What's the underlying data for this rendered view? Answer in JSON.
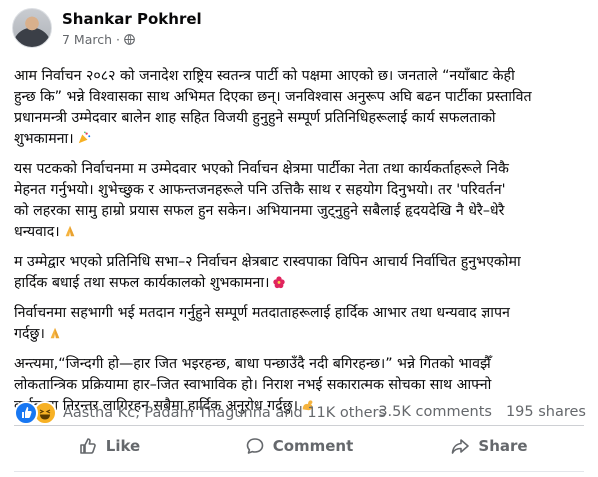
{
  "post": {
    "author": "Shankar Pokhrel",
    "date": "7 March",
    "paragraphs": [
      {
        "lines": [
          "आम निर्वाचन २०८२ को जनादेश राष्ट्रिय स्वतन्त्र पार्टी को पक्षमा आएको छ। जनताले “नयाँबाट केही",
          "हुन्छ कि” भन्ने विश्वासका साथ अभिमत दिएका छन्। जनविश्वास अनुरूप अघि बढन पार्टीका प्रस्तावित",
          "प्रधानमन्त्री उम्मेदवार बालेन शाह सहित विजयी हुनुहुने सम्पूर्ण प्रतिनिधिहरूलाई कार्य सफलताको",
          "शुभकामना।"
        ],
        "emoji": "party-popper-emoji"
      },
      {
        "lines": [
          "यस पटकको निर्वाचनमा म उम्मेदवार भएको निर्वाचन क्षेत्रमा पार्टीका नेता तथा कार्यकर्ताहरूले निकै",
          "मेहनत गर्नुभयो। शुभेच्छुक र आफन्तजनहरूले पनि उत्तिकै साथ र सहयोग दिनुभयो। तर 'परिवर्तन'",
          "को लहरका सामु हाम्रो प्रयास सफल हुन सकेन। अभियानमा जुट्नुहुने सबैलाई हृदयदेखि नै धेरै–धेरै",
          "धन्यवाद।"
        ],
        "emoji": "folded-hands-emoji"
      },
      {
        "lines": [
          "म उम्मेद्वार भएको प्रतिनिधि सभा–२ निर्वाचन क्षेत्रबाट रास्वपाका विपिन आचार्य निर्वाचित हुनुभएकोमा",
          "हार्दिक बधाई तथा सफल कार्यकालको शुभकामना।"
        ],
        "emoji": "hibiscus-emoji"
      },
      {
        "lines": [
          "निर्वाचनमा सहभागी भई मतदान गर्नुहुने सम्पूर्ण मतदाताहरूलाई हार्दिक आभार तथा धन्यवाद ज्ञापन",
          "गर्दछु।"
        ],
        "emoji": "folded-hands-emoji"
      },
      {
        "lines": [
          "अन्त्यमा,“जिन्दगी हो—हार जित भइरहन्छ, बाधा पन्छाउँदै नदी बगिरहन्छ।” भन्ने गितको भावझैँ",
          "लोकतान्त्रिक प्रक्रियामा हार–जित स्वाभाविक हो। निराश नभई सकारात्मक सोचका साथ आफ्नो",
          "कर्तव्यमा निरन्तर लागिरहन सबैमा हार्दिक अनुरोध गर्दछु।"
        ],
        "emoji": "flexed-biceps-emoji"
      }
    ]
  },
  "stats": {
    "reaction_names": "Aastha Kc, Padam Thagunna and 11K others",
    "comments": "3.5K comments",
    "shares": "195 shares"
  },
  "actions": {
    "like": "Like",
    "comment": "Comment",
    "share": "Share"
  },
  "colors": {
    "text": "#080809",
    "secondary": "#65686c",
    "like_blue": "#1877f2",
    "haha_yellow": "#f7b125",
    "divider": "#ced0d4"
  }
}
